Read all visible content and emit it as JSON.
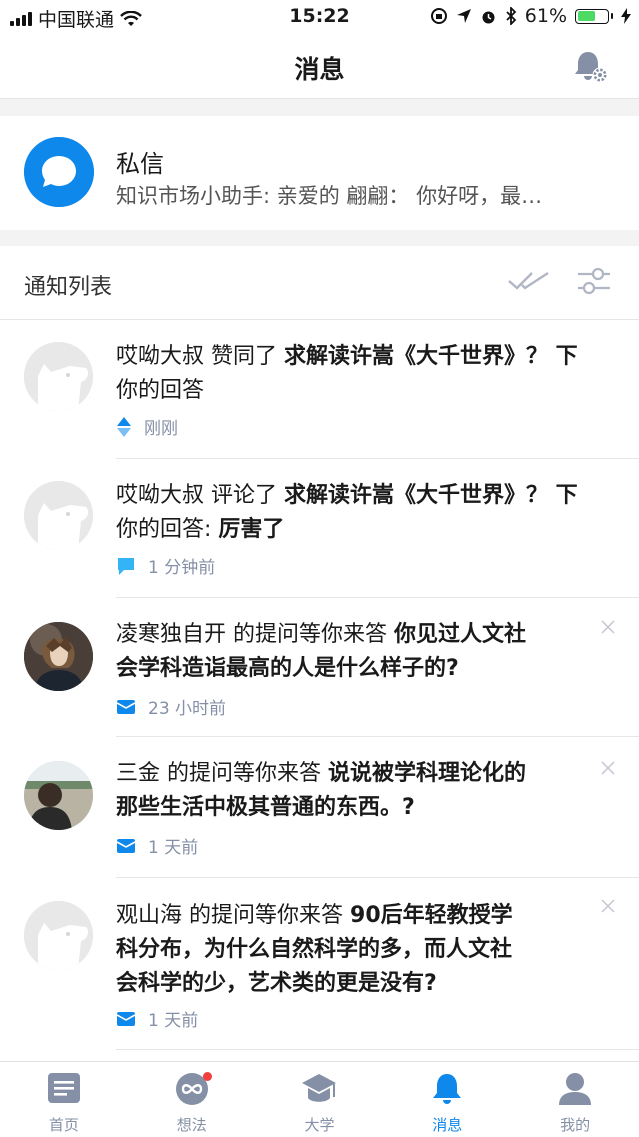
{
  "status_bar": {
    "carrier": "中国联通",
    "time": "15:22",
    "battery": "61%",
    "battery_level": 0.61
  },
  "nav": {
    "title": "消息"
  },
  "private_messages": {
    "title": "私信",
    "preview": "知识市场小助手: 亲爱的 翩翩： 你好呀，最…"
  },
  "list_header": {
    "label": "通知列表"
  },
  "notifications": [
    {
      "actor": "哎呦大叔",
      "action": " 赞同了 ",
      "subject": "求解读许嵩《大千世界》？ 下",
      "line2_plain": "你的回答",
      "line2_bold": "",
      "time": "刚刚",
      "icon": "vote-up-icon"
    },
    {
      "actor": "哎呦大叔",
      "action": " 评论了 ",
      "subject": "求解读许嵩《大千世界》？ 下",
      "line2_plain": "你的回答: ",
      "line2_bold": "厉害了",
      "time": "1 分钟前",
      "icon": "comment-icon"
    },
    {
      "actor": "凌寒独自开",
      "action": " 的提问等你来答 ",
      "subject": "你见过人文社",
      "line2_plain": "",
      "line2_bold": "会学科造诣最高的人是什么样子的?",
      "time": "23 小时前",
      "icon": "envelope-icon"
    },
    {
      "actor": "三金",
      "action": " 的提问等你来答 ",
      "subject": "说说被学科理论化的",
      "line2_plain": "",
      "line2_bold": "那些生活中极其普通的东西。?",
      "time": "1 天前",
      "icon": "envelope-icon"
    },
    {
      "actor": "观山海",
      "action": " 的提问等你来答 ",
      "subject": "90后年轻教授学",
      "line2_plain": "",
      "line2_bold": "科分布，为什么自然科学的多，而人文社",
      "line3_bold": "会科学的少，艺术类的更是没有?",
      "time": "1 天前",
      "icon": "envelope-icon"
    }
  ],
  "tabs": [
    {
      "label": "首页",
      "icon": "home-icon"
    },
    {
      "label": "想法",
      "icon": "ideas-icon",
      "badge_dot": true
    },
    {
      "label": "大学",
      "icon": "university-icon"
    },
    {
      "label": "消息",
      "icon": "bell-icon",
      "active": true
    },
    {
      "label": "我的",
      "icon": "profile-icon"
    }
  ],
  "colors": {
    "accent": "#0f88eb",
    "meta_text": "#8590a6",
    "badge": "#f1403c",
    "section_gap": "#f3f3f4"
  }
}
